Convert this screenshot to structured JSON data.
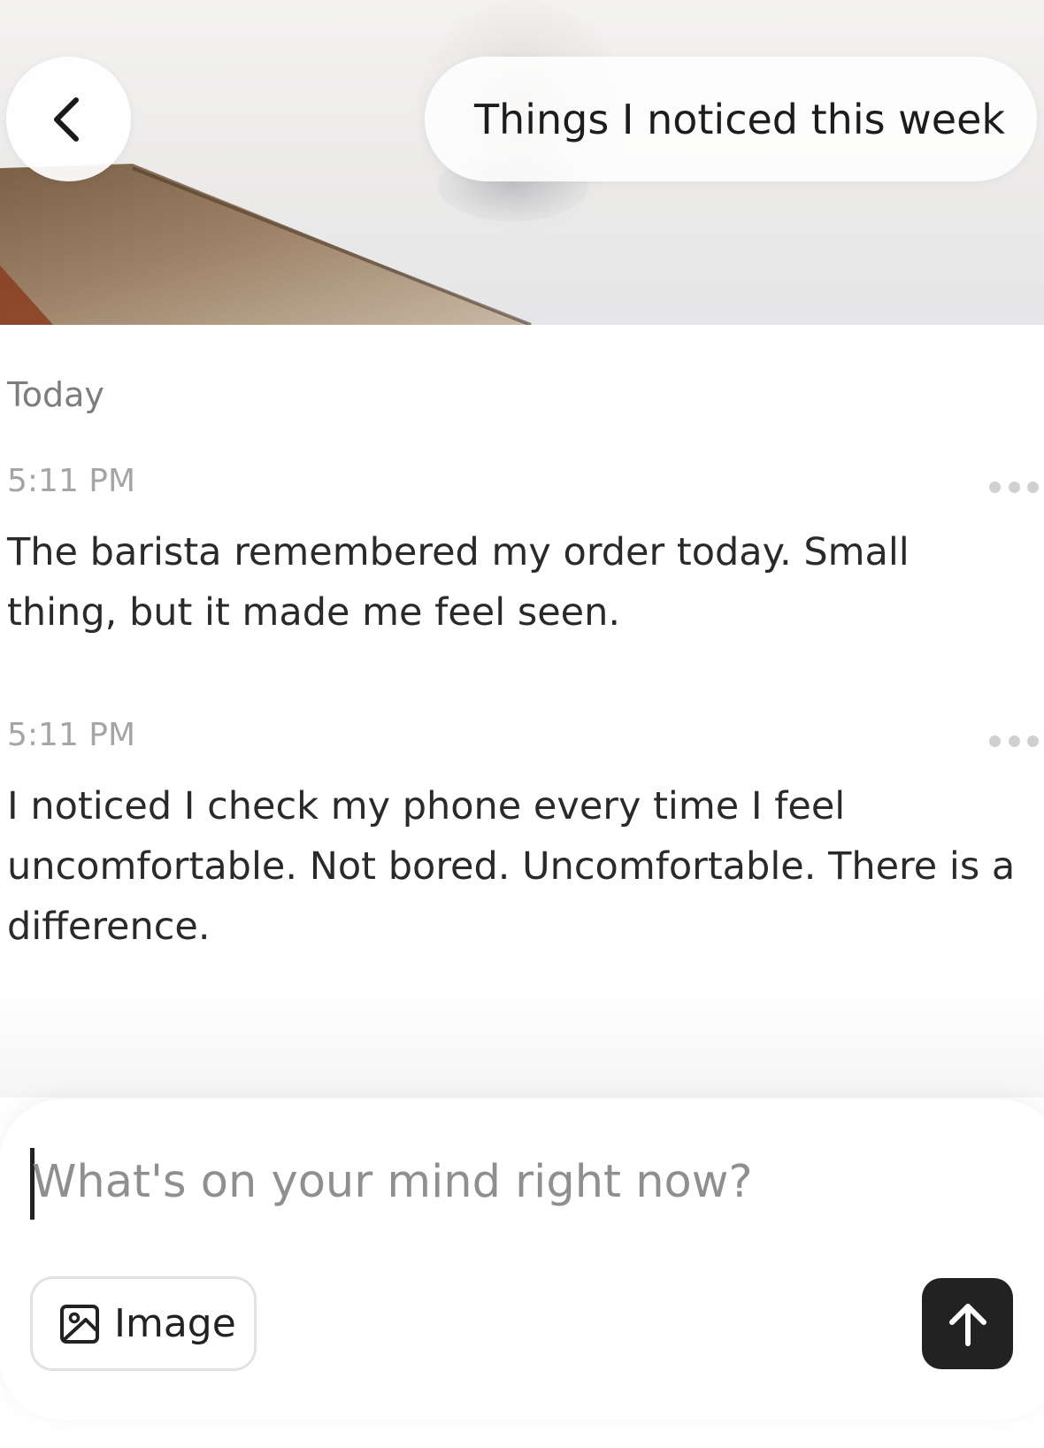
{
  "header": {
    "title": "Things I noticed this week",
    "back_icon": "chevron-left-icon"
  },
  "date_group": {
    "label": "Today"
  },
  "entries": [
    {
      "time": "5:11 PM",
      "text": "The barista remembered my order today. Small thing, but it made me feel seen.",
      "menu_icon": "more-horizontal-icon"
    },
    {
      "time": "5:11 PM",
      "text": "I noticed I check my phone every time I feel uncomfortable. Not bored. Uncomfortable. There is a difference.",
      "menu_icon": "more-horizontal-icon"
    }
  ],
  "composer": {
    "placeholder": "What's on your mind right now?",
    "value": "",
    "image_button_label": "Image",
    "image_icon": "image-icon",
    "send_icon": "arrow-up-icon"
  },
  "colors": {
    "send_button": "#222222",
    "timestamp": "#a5a5a5",
    "body_text": "#2a2a2a"
  }
}
